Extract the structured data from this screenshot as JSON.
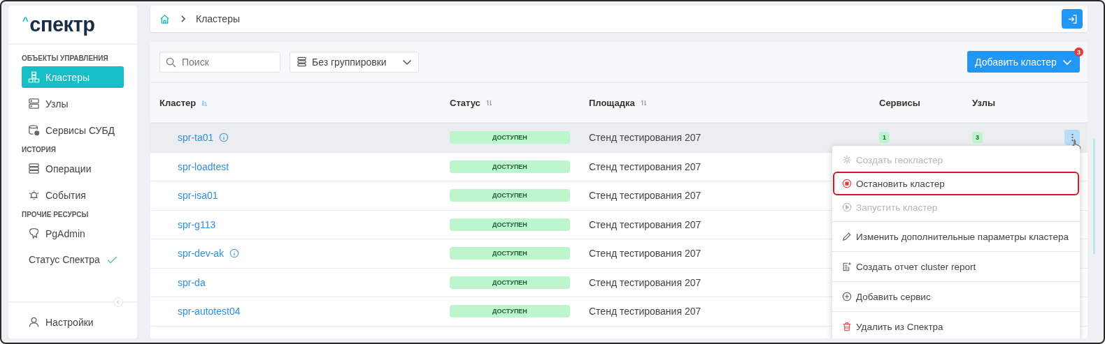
{
  "logo": {
    "mark": "^",
    "text": "спектр"
  },
  "sidebar": {
    "sections": [
      {
        "title": "ОБЪЕКТЫ УПРАВЛЕНИЯ",
        "items": [
          {
            "label": "Кластеры",
            "kind": "clusters",
            "selected": true
          },
          {
            "label": "Узлы",
            "kind": "nodes",
            "selected": false
          },
          {
            "label": "Сервисы СУБД",
            "kind": "services",
            "selected": false
          }
        ]
      },
      {
        "title": "ИСТОРИЯ",
        "items": [
          {
            "label": "Операции",
            "kind": "operations",
            "selected": false
          },
          {
            "label": "События",
            "kind": "events",
            "selected": false
          }
        ]
      },
      {
        "title": "ПРОЧИЕ РЕСУРСЫ",
        "items": [
          {
            "label": "PgAdmin",
            "kind": "pgadmin",
            "selected": false
          }
        ]
      }
    ],
    "status": {
      "label": "Статус Спектра",
      "ok": true
    },
    "settings": {
      "label": "Настройки"
    }
  },
  "breadcrumbs": [
    "Кластеры"
  ],
  "toolbar": {
    "search": {
      "placeholder": "Поиск"
    },
    "grouping": {
      "value": "Без группировки"
    },
    "add_button": {
      "label": "Добавить кластер",
      "badge": "3"
    }
  },
  "table": {
    "columns": [
      {
        "label": "Кластер",
        "sorted": true
      },
      {
        "label": "Статус",
        "sorted": false
      },
      {
        "label": "Площадка",
        "sorted": false
      },
      {
        "label": "Сервисы"
      },
      {
        "label": "Узлы"
      }
    ],
    "rows": [
      {
        "name": "spr-ta01",
        "info": true,
        "status": "ДОСТУПЕН",
        "site": "Стенд тестирования 207",
        "services": "1",
        "nodes": "3",
        "hovered": true
      },
      {
        "name": "spr-loadtest",
        "info": false,
        "status": "ДОСТУПЕН",
        "site": "Стенд тестирования 207",
        "hovered": false
      },
      {
        "name": "spr-isa01",
        "info": false,
        "status": "ДОСТУПЕН",
        "site": "Стенд тестирования 207",
        "hovered": false
      },
      {
        "name": "spr-g113",
        "info": false,
        "status": "ДОСТУПЕН",
        "site": "Стенд тестирования 207",
        "hovered": false
      },
      {
        "name": "spr-dev-ak",
        "info": true,
        "status": "ДОСТУПЕН",
        "site": "Стенд тестирования 207",
        "hovered": false
      },
      {
        "name": "spr-da",
        "info": false,
        "status": "ДОСТУПЕН",
        "site": "Стенд тестирования 207",
        "hovered": false
      },
      {
        "name": "spr-autotest04",
        "info": false,
        "status": "ДОСТУПЕН",
        "site": "Стенд тестирования 207",
        "hovered": false
      }
    ]
  },
  "context_menu": {
    "items": [
      {
        "label": "Создать геокластер",
        "kind": "geocluster",
        "disabled": true,
        "highlighted": false,
        "divider_after": false
      },
      {
        "label": "Остановить кластер",
        "kind": "stop",
        "disabled": false,
        "highlighted": true,
        "divider_after": false
      },
      {
        "label": "Запустить кластер",
        "kind": "start",
        "disabled": true,
        "highlighted": false,
        "divider_after": true
      },
      {
        "label": "Изменить дополнительные параметры кластера",
        "kind": "edit",
        "disabled": false,
        "highlighted": false,
        "divider_after": true
      },
      {
        "label": "Создать отчет cluster report",
        "kind": "report",
        "disabled": false,
        "highlighted": false,
        "divider_after": true
      },
      {
        "label": "Добавить сервис",
        "kind": "add",
        "disabled": false,
        "highlighted": false,
        "divider_after": true
      },
      {
        "label": "Удалить из Спектра",
        "kind": "delete",
        "disabled": false,
        "highlighted": false,
        "divider_after": false
      }
    ]
  }
}
